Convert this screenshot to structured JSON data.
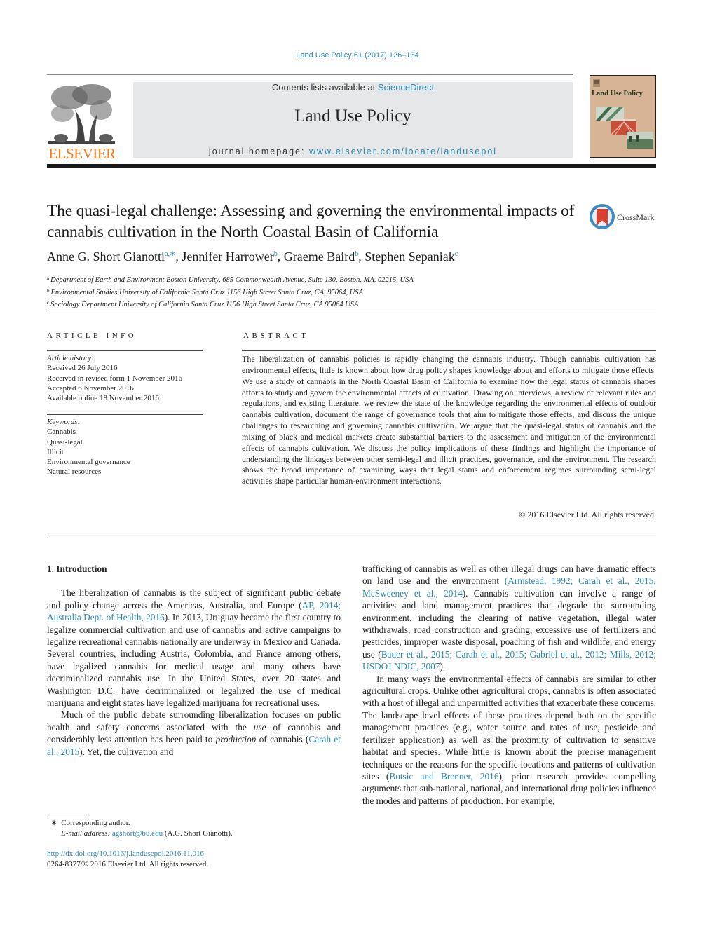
{
  "citation": "Land Use Policy 61 (2017) 126–134",
  "publisher": {
    "logo_word": "ELSEVIER",
    "brand_color": "#f07a1d"
  },
  "journal_header": {
    "contents_prefix": "Contents lists available at ",
    "contents_link": "ScienceDirect",
    "journal_name": "Land Use Policy",
    "homepage_prefix": "journal homepage: ",
    "homepage_link": "www.elsevier.com/locate/landusepol"
  },
  "cover": {
    "title": "Land Use Policy"
  },
  "crossmark": {
    "label": "CrossMark"
  },
  "article": {
    "title": "The quasi-legal challenge: Assessing and governing the environmental impacts of cannabis cultivation in the North Coastal Basin of California",
    "authors": [
      {
        "name": "Anne G. Short Gianotti",
        "sup": "a,∗",
        "sep": ", "
      },
      {
        "name": "Jennifer Harrower",
        "sup": "b",
        "sep": ", "
      },
      {
        "name": "Graeme Baird",
        "sup": "b",
        "sep": ", "
      },
      {
        "name": "Stephen Sepaniak",
        "sup": "c",
        "sep": ""
      }
    ],
    "affiliations": [
      {
        "mark": "a",
        "text": "Department of Earth and Environment Boston University, 685 Commonwealth Avenue, Suite 130, Boston, MA, 02215, USA"
      },
      {
        "mark": "b",
        "text": "Environmental Studies University of California Santa Cruz 1156 High Street Santa Cruz, CA, 95064, USA"
      },
      {
        "mark": "c",
        "text": "Sociology Department University of California Santa Cruz 1156 High Street Santa Cruz, CA 95064 USA"
      }
    ]
  },
  "article_info": {
    "heading": "ARTICLE INFO",
    "history_label": "Article history:",
    "history": [
      "Received 26 July 2016",
      "Received in revised form 1 November 2016",
      "Accepted 6 November 2016",
      "Available online 18 November 2016"
    ],
    "keywords_label": "Keywords:",
    "keywords": [
      "Cannabis",
      "Quasi-legal",
      "Illicit",
      "Environmental governance",
      "Natural resources"
    ]
  },
  "abstract": {
    "heading": "ABSTRACT",
    "text": "The liberalization of cannabis policies is rapidly changing the cannabis industry. Though cannabis cul­tivation has environmental effects, little is known about how drug policy shapes knowledge about and efforts to mitigate those effects. We use a study of cannabis in the North Coastal Basin of California to examine how the legal status of cannabis shapes efforts to study and govern the environmental effects of cultivation. Drawing on interviews, a review of relevant rules and regulations, and existing literature, we review the state of the knowledge regarding the environmental effects of outdoor cannabis cultiva­tion, document the range of governance tools that aim to mitigate those effects, and discuss the unique challenges to researching and governing cannabis cultivation. We argue that the quasi-legal status of cannabis and the mixing of black and medical markets create substantial barriers to the assessment and mitigation of the environmental effects of cannabis cultivation. We discuss the policy implications of these findings and highlight the importance of understanding the linkages between other semi-legal and illicit practices, governance, and the environment. The research shows the broad importance of exam­ining ways that legal status and enforcement regimes surrounding semi-legal activities shape particular human-environment interactions.",
    "copyright": "© 2016 Elsevier Ltd. All rights reserved."
  },
  "body": {
    "section_heading": "1.  Introduction",
    "left": {
      "p1_a": "The liberalization of cannabis is the subject of significant pub­lic debate and policy change across the Americas, Australia, and Europe (",
      "p1_cite": "AP, 2014; Australia Dept. of Health, 2016",
      "p1_b": "). In 2013, Uruguay became the first country to legalize commercial cultivation and use of cannabis and active campaigns to legalize recreational cannabis nationally are underway in Mexico and Canada. Several countries, including Austria, Colombia, and France among others, have legalized cannabis for medical usage and many others have decriminalized cannabis use. In the United States, over 20 states and Washington D.C. have decriminalized or legalized the use of medical marijuana and eight states have legalized marijuana for recreational uses.",
      "p2_a": "Much of the public debate surrounding liberalization focuses on public health and safety concerns associated with the ",
      "p2_em1": "use",
      "p2_b": " of cannabis and considerably less attention has been paid to ",
      "p2_em2": "pro­duction",
      "p2_c": " of cannabis (",
      "p2_cite": "Carah et al., 2015",
      "p2_d": "). Yet, the cultivation and"
    },
    "right": {
      "p1_a": "trafficking of cannabis as well as other illegal drugs can have dra­matic effects on land use and the environment ",
      "p1_cite1": "(Armstead, 1992; Carah et al., 2015; McSweeney et al., 2014",
      "p1_b": "). Cannabis cultivation can involve a range of activities and land management practices that degrade the surrounding environment, including the clearing of native vegetation, illegal water withdrawals, road construction and grading, excessive use of fertilizers and pesticides, improper waste disposal, poaching of fish and wildlife, and energy use (",
      "p1_cite2": "Bauer et al., 2015; Carah et al., 2015; Gabriel et al., 2012; Mills, 2012; USDOJ NDIC, 2007",
      "p1_c": ").",
      "p2_a": "In many ways the environmental effects of cannabis are similar to other agricultural crops. Unlike other agricultural crops, cannabis is often associated with a host of illegal and unpermitted activities that exacerbate these concerns. The landscape level effects of these practices depend both on the specific management practices (e.g., water source and rates of use, pesticide and fertilizer application) as well as the proximity of cultivation to sensitive habitat and species. While little is known about the precise management techniques or the reasons for the specific locations and patterns of cultivation sites (",
      "p2_cite": "Butsic and Brenner, 2016",
      "p2_b": "), prior research provides compelling arguments that sub-national, national, and international drug poli­cies influence the modes and patterns of production. For example,"
    }
  },
  "footnotes": {
    "star": "∗",
    "corresponding": "Corresponding author.",
    "email_label": "E-mail address:",
    "email": "agshort@bu.edu",
    "email_suffix": " (A.G. Short Gianotti)."
  },
  "doi": {
    "link": "http://dx.doi.org/10.1016/j.landusepol.2016.11.016",
    "issn_line": "0264-8377/© 2016 Elsevier Ltd. All rights reserved."
  },
  "colors": {
    "link": "#2a8ab3",
    "header_box": "#e6e7e8",
    "cover_bg": "#d8b497",
    "crossmark_red": "#d8412f",
    "crossmark_blue": "#3a8cc6"
  }
}
